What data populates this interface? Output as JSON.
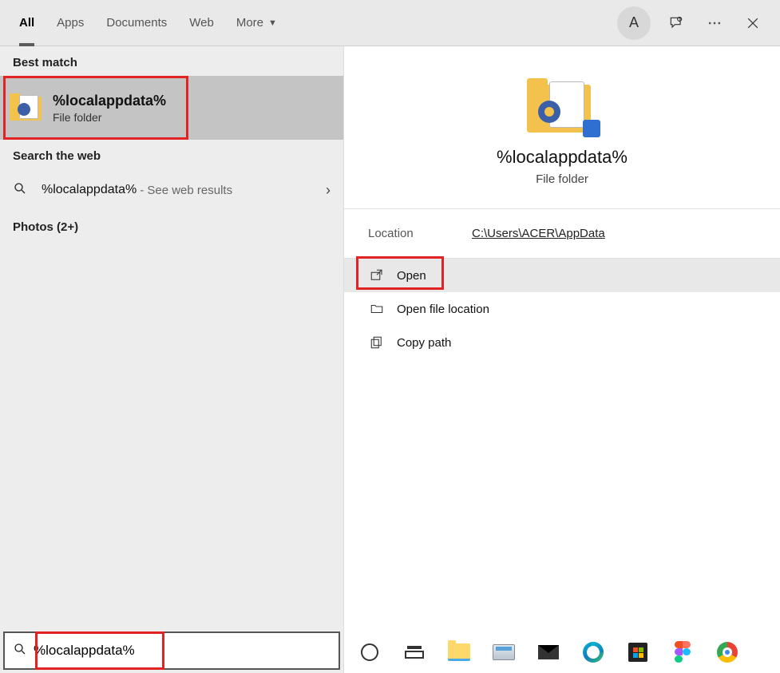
{
  "header": {
    "tabs": [
      "All",
      "Apps",
      "Documents",
      "Web",
      "More"
    ],
    "active_tab": "All",
    "avatar_initial": "A"
  },
  "left": {
    "best_match_label": "Best match",
    "best_item": {
      "title": "%localappdata%",
      "subtitle": "File folder"
    },
    "search_web_label": "Search the web",
    "web_item": {
      "main": "%localappdata%",
      "suffix": "- See web results"
    },
    "photos_label": "Photos (2+)"
  },
  "right": {
    "title": "%localappdata%",
    "subtitle": "File folder",
    "location_label": "Location",
    "location_value": "C:\\Users\\ACER\\AppData",
    "actions": {
      "open": "Open",
      "open_loc": "Open file location",
      "copy_path": "Copy path"
    }
  },
  "search": {
    "value": "%localappdata%"
  },
  "taskbar_icons": [
    "cortana",
    "task-view",
    "file-explorer",
    "keyboard",
    "mail",
    "edge",
    "store",
    "figma",
    "chrome"
  ]
}
